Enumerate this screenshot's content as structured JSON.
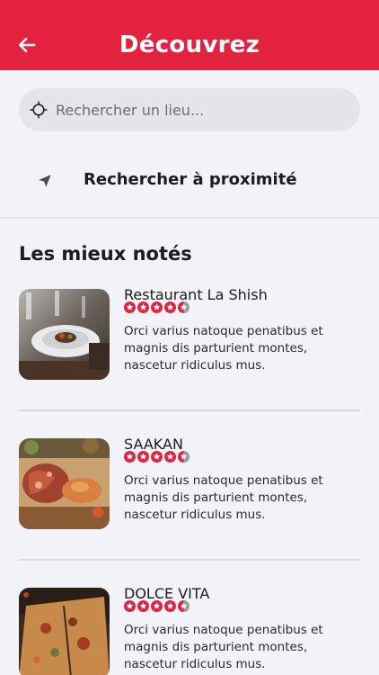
{
  "header": {
    "title": "Découvrez",
    "back_icon": "arrow-left-icon"
  },
  "search": {
    "placeholder": "Rechercher un lieu...",
    "icon": "crosshair-icon"
  },
  "nearby": {
    "label": "Rechercher à proximité",
    "icon": "navigation-arrow-icon"
  },
  "section": {
    "title": "Les mieux notés"
  },
  "colors": {
    "brand": "#e2223f",
    "star": "#e2223f",
    "star_empty": "#9a9aa0"
  },
  "restaurants": [
    {
      "name": "Restaurant La Shish",
      "rating": 4.5,
      "description": "Orci varius natoque penatibus et magnis dis parturient montes, nascetur ridiculus mus."
    },
    {
      "name": "SAAKAN",
      "rating": 4.5,
      "description": "Orci varius natoque penatibus et magnis dis parturient montes, nascetur ridiculus mus."
    },
    {
      "name": "DOLCE VITA",
      "rating": 4.5,
      "description": "Orci varius natoque penatibus et magnis dis parturient montes, nascetur ridiculus mus."
    }
  ]
}
